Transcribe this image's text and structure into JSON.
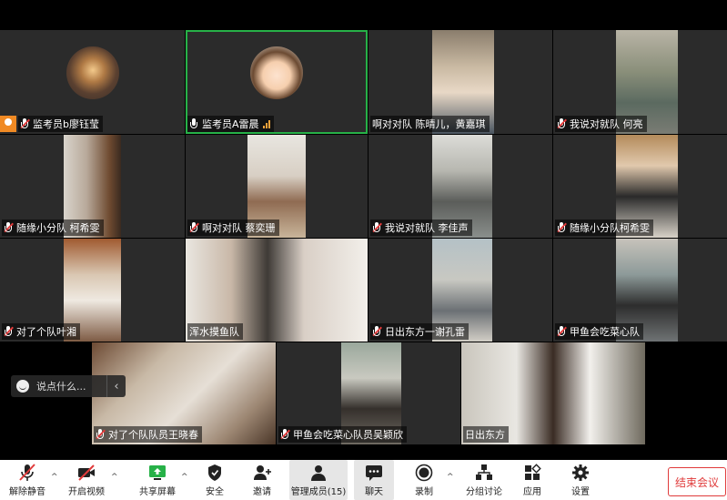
{
  "tiles": {
    "t1": {
      "name": "监考员b廖钰莹"
    },
    "t2": {
      "name": "监考员A雷晨"
    },
    "t3": {
      "name": "啊对对队 陈晴儿，黄嘉琪"
    },
    "t4": {
      "name": "我说对就队 何亮"
    },
    "t5": {
      "name": "随缘小分队 柯希雯"
    },
    "t6": {
      "name": "啊对对队 蔡奕珊"
    },
    "t7": {
      "name": "我说对就队 李佳声"
    },
    "t8": {
      "name": "随缘小分队柯希雯"
    },
    "t9": {
      "name": "对了个队叶湘"
    },
    "t10": {
      "name": "浑水摸鱼队"
    },
    "t11": {
      "name": "日出东方一谢孔雷"
    },
    "t12": {
      "name": "甲鱼会吃菜心队"
    },
    "t13": {
      "name": "对了个队队员王晓春"
    },
    "t14": {
      "name": "甲鱼会吃菜心队员吴颖欣"
    },
    "t15": {
      "name": "日出东方"
    }
  },
  "chat": {
    "placeholder": "说点什么...",
    "collapse_glyph": "‹"
  },
  "toolbar": {
    "unmute": "解除静音",
    "start_video": "开启视频",
    "share_screen": "共享屏幕",
    "security": "安全",
    "invite": "邀请",
    "manage_members": "管理成员(15)",
    "chat": "聊天",
    "record": "录制",
    "breakout": "分组讨论",
    "apps": "应用",
    "settings": "设置",
    "end_meeting": "结束会议",
    "caret": "^"
  },
  "colors": {
    "accent_green": "#27b148",
    "danger_red": "#e03b3b",
    "host_orange": "#f08a24",
    "tile_bg": "#2b2b2b"
  },
  "icons": [
    "mic-muted-icon",
    "video-off-icon",
    "share-screen-icon",
    "shield-icon",
    "add-user-icon",
    "members-icon",
    "chat-icon",
    "record-icon",
    "breakout-icon",
    "apps-icon",
    "gear-icon",
    "signal-icon",
    "host-icon",
    "smile-icon"
  ]
}
